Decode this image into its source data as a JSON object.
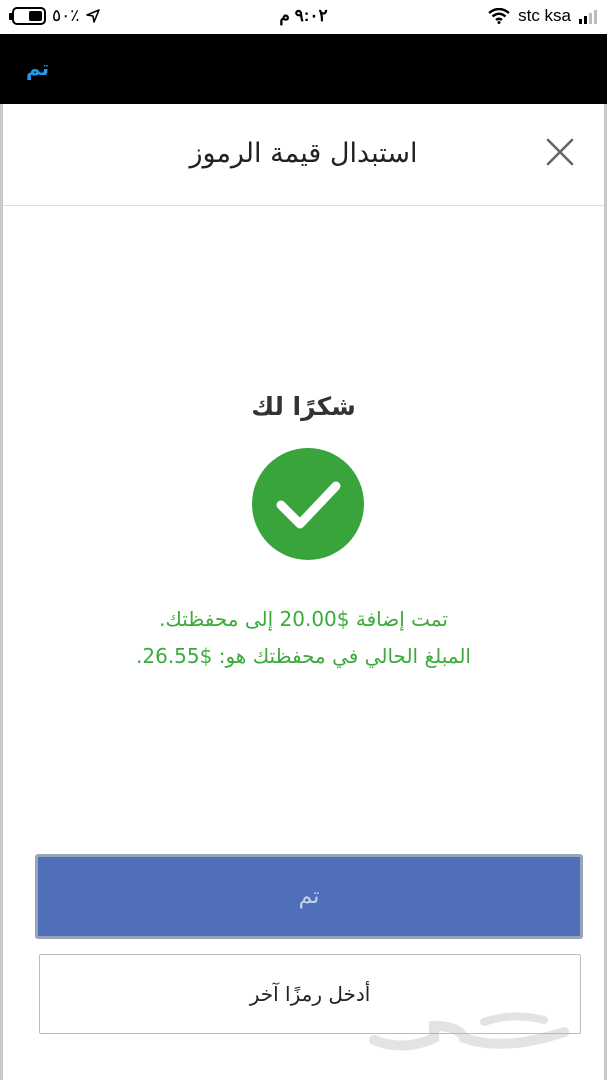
{
  "status_bar": {
    "battery_percent": "٥٠٪",
    "battery_level": 0.5,
    "time": "٩:٠٢ م",
    "carrier": "stc ksa"
  },
  "topnav": {
    "done_label": "تم",
    "accent_color": "#1e9bf0"
  },
  "modal": {
    "title": "استبدال قيمة الرموز",
    "close_icon": "close-icon",
    "thanks": "شكرًا لك",
    "success_icon": "check-circle-icon",
    "success_color": "#3bab3b",
    "message_line1": "تمت إضافة $20.00 إلى محفظتك.",
    "message_line2": "المبلغ الحالي في محفظتك هو: $26.55.",
    "primary_button": "تم",
    "secondary_button": "أدخل رمزًا آخر",
    "primary_color": "#4f6fb9"
  },
  "watermark": {
    "text": "حراج"
  }
}
